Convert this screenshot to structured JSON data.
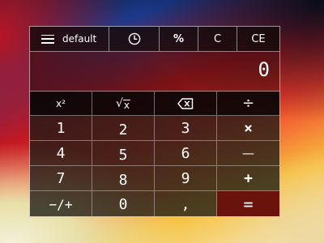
{
  "window": {
    "accent_color": "#6a130c"
  },
  "toolbar": {
    "menu_icon": "hamburger-icon",
    "menu_label": "default",
    "history_icon": "clock-icon",
    "percent_label": "%",
    "clear_label": "C",
    "clear_entry_label": "CE"
  },
  "display": {
    "value": "0"
  },
  "keypad": {
    "square": "x²",
    "sqrt": "x",
    "backspace_icon": "backspace-icon",
    "divide": "÷",
    "one": "1",
    "two": "2",
    "three": "3",
    "multiply": "×",
    "four": "4",
    "five": "5",
    "six": "6",
    "subtract": "—",
    "seven": "7",
    "eight": "8",
    "nine": "9",
    "add": "+",
    "negate": "−/+",
    "zero": "0",
    "decimal": ",",
    "equals": "="
  }
}
